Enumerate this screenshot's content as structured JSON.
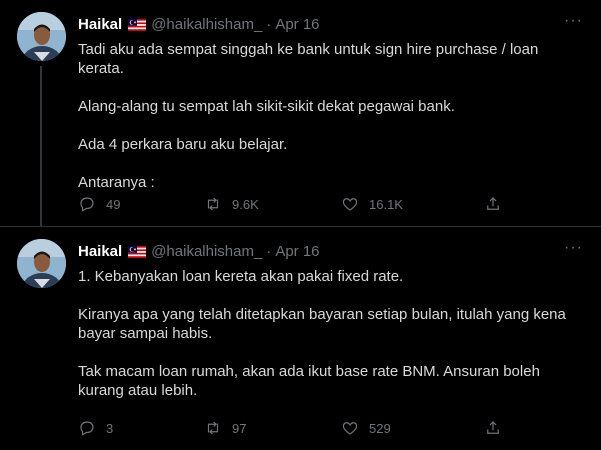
{
  "tweets": [
    {
      "author": {
        "name": "Haikal",
        "handle": "@haikalhisham_",
        "date": "Apr 16"
      },
      "separator": "·",
      "more": "···",
      "paragraphs": [
        "Tadi aku ada sempat singgah ke bank untuk sign hire purchase / loan kerata.",
        "Alang-alang tu sempat lah sikit-sikit dekat pegawai bank.",
        "Ada 4 perkara baru aku belajar.",
        "Antaranya :"
      ],
      "stats": {
        "replies": "49",
        "retweets": "9.6K",
        "likes": "16.1K"
      }
    },
    {
      "author": {
        "name": "Haikal",
        "handle": "@haikalhisham_",
        "date": "Apr 16"
      },
      "separator": "·",
      "more": "···",
      "paragraphs": [
        "1. Kebanyakan loan kereta akan pakai fixed rate.",
        "Kiranya apa yang telah ditetapkan bayaran setiap bulan, itulah yang kena bayar sampai habis.",
        "Tak macam loan rumah, akan ada ikut base rate BNM. Ansuran boleh kurang atau lebih."
      ],
      "stats": {
        "replies": "3",
        "retweets": "97",
        "likes": "529"
      }
    }
  ],
  "icons": {
    "reply": "reply-icon",
    "retweet": "retweet-icon",
    "like": "heart-icon",
    "share": "share-icon",
    "flag": "malaysia-flag-icon"
  },
  "colors": {
    "background": "#000000",
    "text": "#d9d9d9",
    "muted": "#71767b",
    "divider": "#2f3336"
  }
}
